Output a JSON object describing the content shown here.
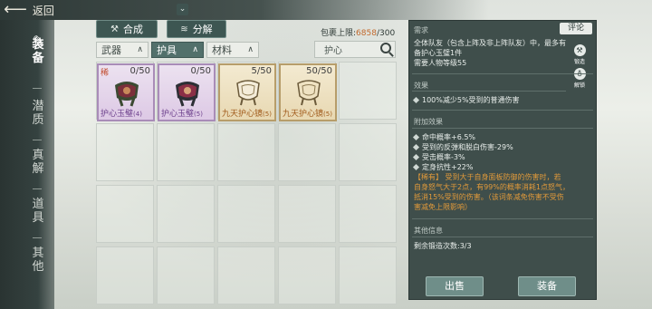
{
  "header": {
    "back_label": "返回",
    "collapse_icon": "double-chevron-down-icon"
  },
  "sidebar": {
    "items": [
      {
        "label": "装备",
        "active": true
      },
      {
        "label": "潜质"
      },
      {
        "label": "真解"
      },
      {
        "label": "道具"
      },
      {
        "label": "其他"
      }
    ]
  },
  "toolbar": {
    "synthesize_label": "合成",
    "decompose_label": "分解"
  },
  "filters": {
    "weapon": "武器",
    "armor": "护具",
    "material": "材料"
  },
  "bag": {
    "capacity_label": "包裹上限:",
    "current": "6858",
    "max": "/300"
  },
  "search": {
    "value": "护心"
  },
  "items": [
    {
      "name": "护心玉璧",
      "level": "(4)",
      "count": "0/50",
      "tag": "稀",
      "rarity": "purple"
    },
    {
      "name": "护心玉璧",
      "level": "(5)",
      "count": "0/50",
      "tag": "",
      "rarity": "purple"
    },
    {
      "name": "九天护心镜",
      "level": "(5)",
      "count": "5/50",
      "tag": "",
      "rarity": "gold"
    },
    {
      "name": "九天护心镜",
      "level": "(5)",
      "count": "50/50",
      "tag": "",
      "rarity": "gold"
    }
  ],
  "detail": {
    "requirement_title": "需求",
    "comment_label": "评论",
    "requirement_lines": [
      "全体队友（包含上阵及非上阵队友）中，最多有",
      "备护心玉璧1件",
      "需要人物等级55"
    ],
    "forge_label": "锻造",
    "unbind_label": "解锁",
    "effect_title": "效果",
    "effect_line": "100%减少5%受到的普通伤害",
    "extra_title": "附加效果",
    "extra_lines": [
      "命中概率+6.5%",
      "受到的反弹和脱白伤害-29%",
      "受击概率-3%",
      "定身抗性+22%"
    ],
    "rare_lines": [
      "【稀有】 受到大于自身面板防御的伤害时，若",
      "自身怒气大于2点，有99%的概率消耗1点怒气，",
      "抵消15%受到的伤害。（该词条减免伤害不受伤",
      "害减免上限影响）"
    ],
    "other_title": "其他信息",
    "remaining": "剩余锻造次数:3/3",
    "sell_label": "出售",
    "equip_label": "装备"
  }
}
